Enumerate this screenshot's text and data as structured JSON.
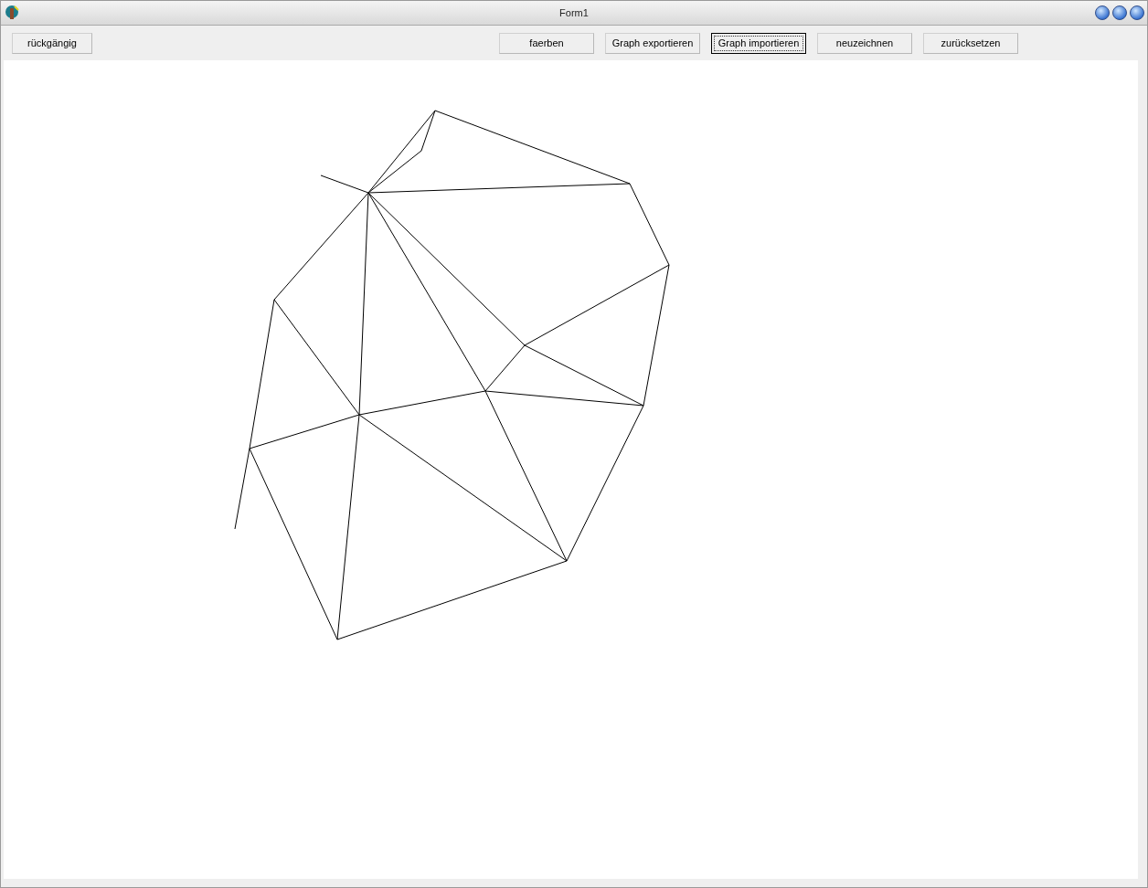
{
  "window": {
    "title": "Form1"
  },
  "toolbar": {
    "left_buttons": [
      {
        "label": "rückgängig",
        "focused": false
      }
    ],
    "right_buttons": [
      {
        "label": "faerben",
        "focused": false
      },
      {
        "label": "Graph exportieren",
        "focused": false
      },
      {
        "label": "Graph importieren",
        "focused": true
      },
      {
        "label": "neuzeichnen",
        "focused": false
      },
      {
        "label": "zurücksetzen",
        "focused": false
      }
    ]
  }
}
